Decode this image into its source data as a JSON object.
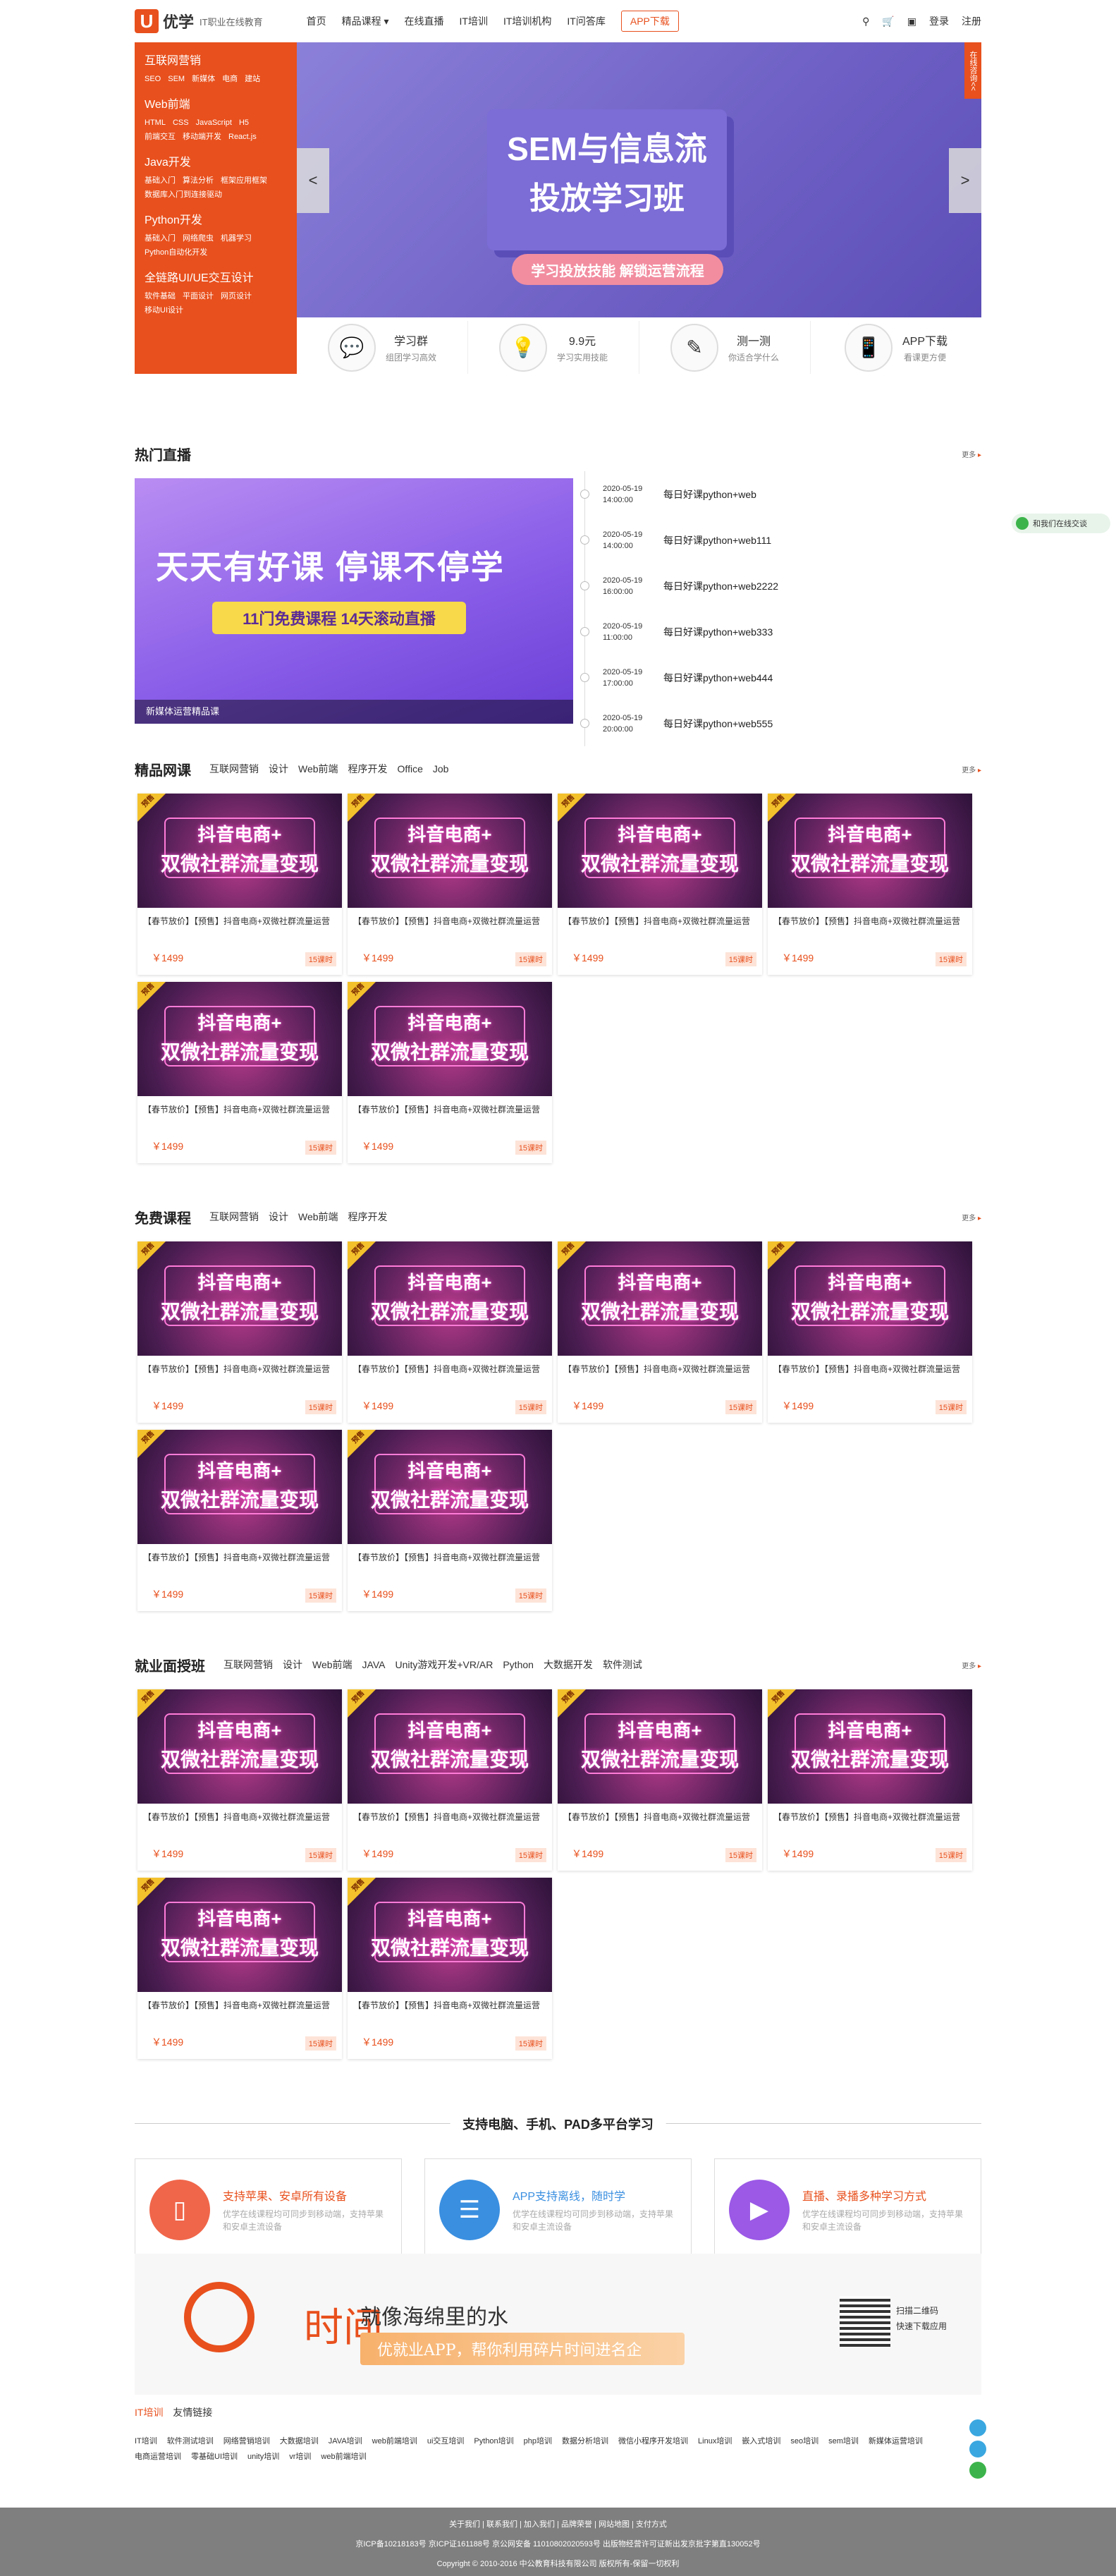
{
  "header": {
    "logo_mark": "U",
    "logo_name": "优学",
    "logo_tagline": "IT职业在线教育",
    "nav": [
      "首页",
      "精品课程 ▾",
      "在线直播",
      "IT培训",
      "IT培训机构",
      "IT问答库"
    ],
    "app_button": "APP下载",
    "login": "登录",
    "register": "注册"
  },
  "sidemenu": [
    {
      "title": "互联网营销",
      "items": [
        "SEO",
        "SEM",
        "新媒体",
        "电商",
        "建站"
      ]
    },
    {
      "title": "Web前端",
      "items": [
        "HTML",
        "CSS",
        "JavaScript",
        "H5",
        "前端交互",
        "移动端开发",
        "React.js"
      ]
    },
    {
      "title": "Java开发",
      "items": [
        "基础入门",
        "算法分析",
        "框架应用框架",
        "数据库入门到连接驱动"
      ]
    },
    {
      "title": "Python开发",
      "items": [
        "基础入门",
        "网络爬虫",
        "机器学习",
        "Python自动化开发"
      ]
    },
    {
      "title": "全链路UI/UE交互设计",
      "items": [
        "软件基础",
        "平面设计",
        "网页设计",
        "移动UI设计"
      ]
    }
  ],
  "banner": {
    "title": "SEM与信息流",
    "subtitle": "投放学习班",
    "pill": "学习投放技能  解锁运营流程",
    "corner_tag": "在线咨询<<",
    "prev": "<",
    "next": ">"
  },
  "features": [
    {
      "icon": "group-chat-icon",
      "title": "学习群",
      "desc": "组团学习高效"
    },
    {
      "icon": "lightbulb-icon",
      "title": "9.9元",
      "desc": "学习实用技能"
    },
    {
      "icon": "quiz-pencil-icon",
      "title": "测一测",
      "desc": "你适合学什么"
    },
    {
      "icon": "app-download-icon",
      "title": "APP下载",
      "desc": "看课更方便"
    }
  ],
  "live": {
    "title": "热门直播",
    "more": "更多",
    "banner_h1": "天天有好课  停课不停学",
    "banner_h2": "11门免费课程 14天滚动直播",
    "banner_caption": "新媒体运营精品课",
    "schedule": [
      {
        "date": "2020-05-19",
        "time": "14:00:00",
        "title": "每日好课python+web"
      },
      {
        "date": "2020-05-19",
        "time": "14:00:00",
        "title": "每日好课python+web111"
      },
      {
        "date": "2020-05-19",
        "time": "16:00:00",
        "title": "每日好课python+web2222"
      },
      {
        "date": "2020-05-19",
        "time": "11:00:00",
        "title": "每日好课python+web333"
      },
      {
        "date": "2020-05-19",
        "time": "17:00:00",
        "title": "每日好课python+web444"
      },
      {
        "date": "2020-05-19",
        "time": "20:00:00",
        "title": "每日好课python+web555"
      }
    ]
  },
  "course_card": {
    "tag": "预售",
    "img_line1": "抖音电商+",
    "img_line2": "双微社群流量变现",
    "title": "【春节放价】【预售】抖音电商+双微社群流量运营",
    "price": "￥1499",
    "lessons": "15课时"
  },
  "sections": [
    {
      "title": "精品网课",
      "tabs": [
        "互联网营销",
        "设计",
        "Web前端",
        "程序开发",
        "Office",
        "Job"
      ],
      "more": "更多"
    },
    {
      "title": "免费课程",
      "tabs": [
        "互联网营销",
        "设计",
        "Web前端",
        "程序开发"
      ],
      "more": "更多"
    },
    {
      "title": "就业面授班",
      "tabs": [
        "互联网营销",
        "设计",
        "Web前端",
        "JAVA",
        "Unity游戏开发+VR/AR",
        "Python",
        "大数据开发",
        "软件测试"
      ],
      "more": "更多"
    }
  ],
  "platform": {
    "title": "支持电脑、手机、PAD多平台学习",
    "boxes": [
      {
        "icon": "phone-icon",
        "title": "支持苹果、安卓所有设备",
        "desc": "优学在线课程均可同步到移动端，支持苹果和安卓主流设备",
        "color": "#f0664a",
        "title_color": "#e8501d"
      },
      {
        "icon": "book-icon",
        "title": "APP支持离线，随时学",
        "desc": "优学在线课程均可同步到移动端，支持苹果和安卓主流设备",
        "color": "#3a8fe0",
        "title_color": "#3a8fe0"
      },
      {
        "icon": "play-video-icon",
        "title": "直播、录播多种学习方式",
        "desc": "优学在线课程均可同步到移动端，支持苹果和安卓主流设备",
        "color": "#9b59e6",
        "title_color": "#e8501d"
      }
    ]
  },
  "promo": {
    "big": "时间",
    "text": "就像海绵里的水",
    "bar": "优就业APP，帮你利用碎片时间进名企",
    "qr_line1": "扫描二维码",
    "qr_line2": "快速下载应用"
  },
  "links": {
    "head_highlight": "IT培训",
    "head": "友情链接",
    "items": [
      "IT培训",
      "软件测试培训",
      "网络营销培训",
      "大数据培训",
      "JAVA培训",
      "web前端培训",
      "ui交互培训",
      "Python培训",
      "php培训",
      "数据分析培训",
      "微信小程序开发培训",
      "Linux培训",
      "嵌入式培训",
      "seo培训",
      "sem培训",
      "新媒体运营培训",
      "电商运营培训",
      "零基础UI培训",
      "unity培训",
      "vr培训",
      "web前端培训"
    ]
  },
  "footer": {
    "line1": "关于我们 | 联系我们 | 加入我们 | 品牌荣誉 | 网站地图 | 支付方式",
    "line2": "京ICP备10218183号   京ICP证161188号   京公网安备 11010802020593号   出版物经营许可证新出发京批字第直130052号",
    "line3": "Copyright © 2010-2016 中公教育科技有限公司 版权所有-保留一切权利"
  },
  "float_chat": "和我们在线交谈"
}
